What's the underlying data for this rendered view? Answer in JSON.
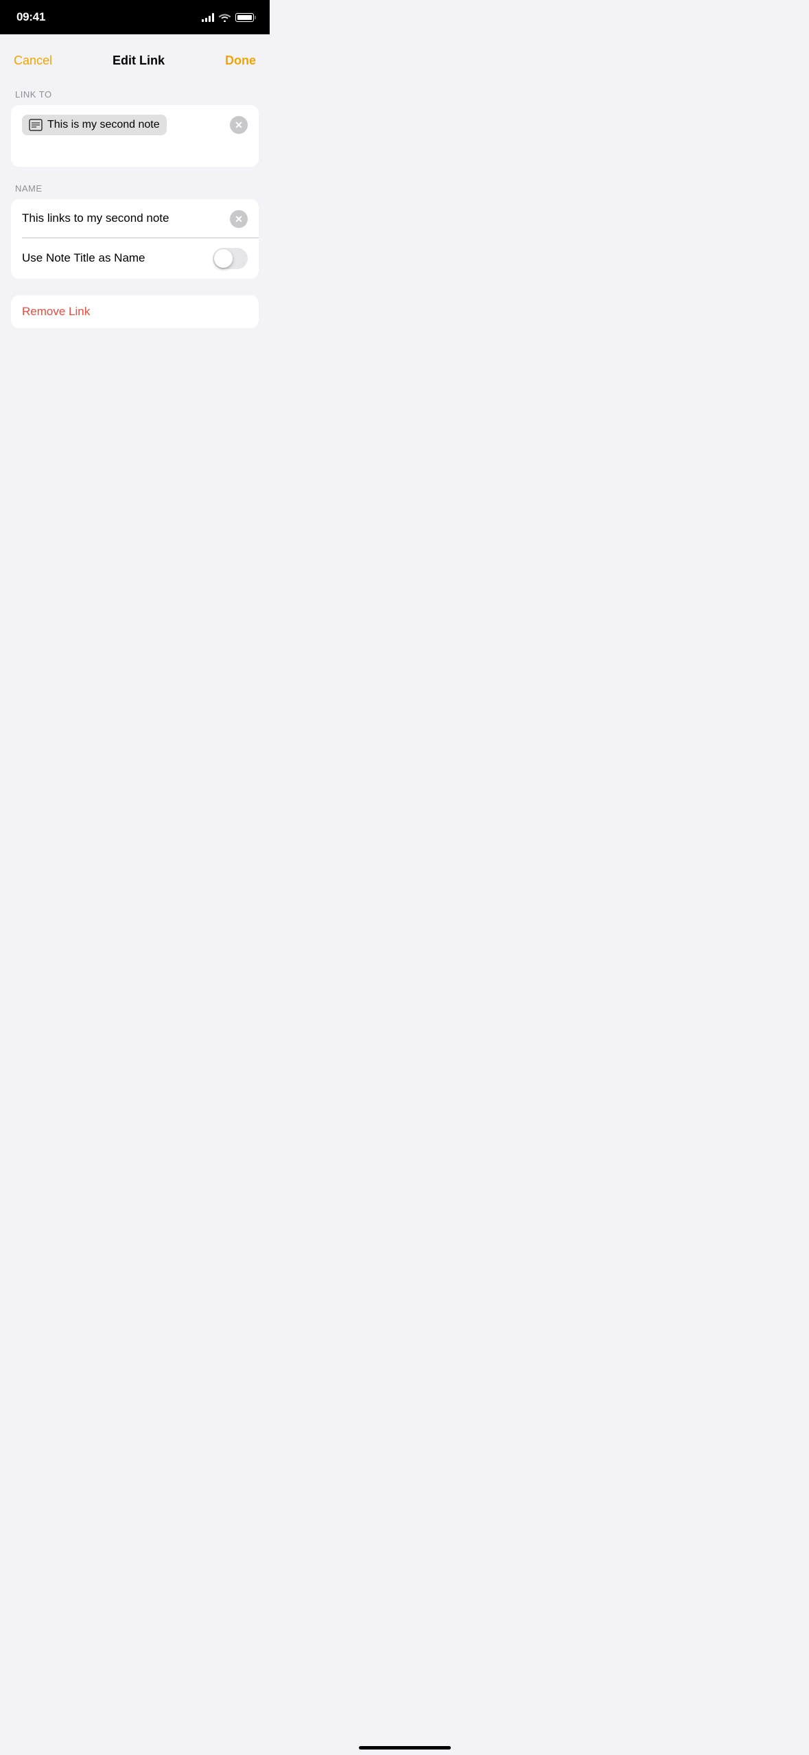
{
  "statusBar": {
    "time": "09:41",
    "signalBars": 4,
    "wifi": true,
    "battery": 100
  },
  "nav": {
    "cancelLabel": "Cancel",
    "title": "Edit Link",
    "doneLabel": "Done"
  },
  "linkToSection": {
    "sectionLabel": "LINK TO",
    "chipText": "This is my second note",
    "chipIconAlt": "note-icon"
  },
  "nameSection": {
    "sectionLabel": "NAME",
    "nameValue": "This links to my second note",
    "toggleLabel": "Use Note Title as Name",
    "toggleOn": false
  },
  "removeLink": {
    "label": "Remove Link"
  },
  "homeIndicator": {}
}
